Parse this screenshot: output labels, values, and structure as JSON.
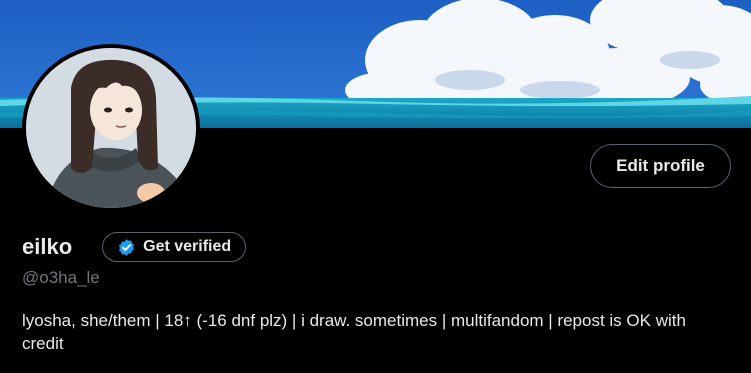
{
  "profile": {
    "display_name": "eilko",
    "handle": "@o3ha_le",
    "bio": "lyosha, she/them | 18↑ (-16 dnf plz) | i draw. sometimes | multifandom | repost is OK with credit",
    "edit_profile_label": "Edit profile",
    "get_verified_label": "Get verified",
    "verified_badge_icon": "verified-badge-icon"
  },
  "colors": {
    "background": "#000000",
    "text_primary": "#e7e9ea",
    "text_secondary": "#71767b",
    "button_border": "#536471",
    "verified_blue": "#1d9bf0",
    "sky": "#1f64c8",
    "sea": "#17b5cf"
  }
}
